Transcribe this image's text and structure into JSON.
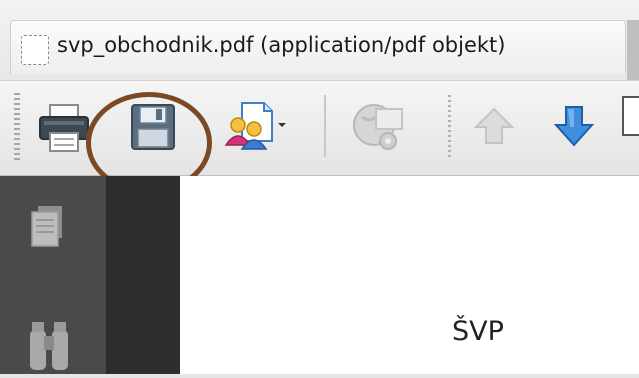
{
  "tab": {
    "title": "svp_obchodnik.pdf (application/pdf objekt)"
  },
  "toolbar": {
    "buttons": [
      {
        "name": "print",
        "icon": "printer-icon"
      },
      {
        "name": "save",
        "icon": "floppy-disk-icon"
      },
      {
        "name": "share",
        "icon": "document-people-icon"
      },
      {
        "name": "web",
        "icon": "globe-gear-icon"
      },
      {
        "name": "previous-page",
        "icon": "arrow-up-icon"
      },
      {
        "name": "next-page",
        "icon": "arrow-down-icon"
      }
    ]
  },
  "sidebar": {
    "items": [
      {
        "icon": "pages-icon"
      },
      {
        "icon": "binoculars-icon"
      }
    ]
  },
  "document": {
    "visible_text": "ŠVP"
  },
  "colors": {
    "highlight_ring": "#7b4a24",
    "arrow_blue": "#2f78d0",
    "sidebar_bg": "#4a4a4a"
  }
}
